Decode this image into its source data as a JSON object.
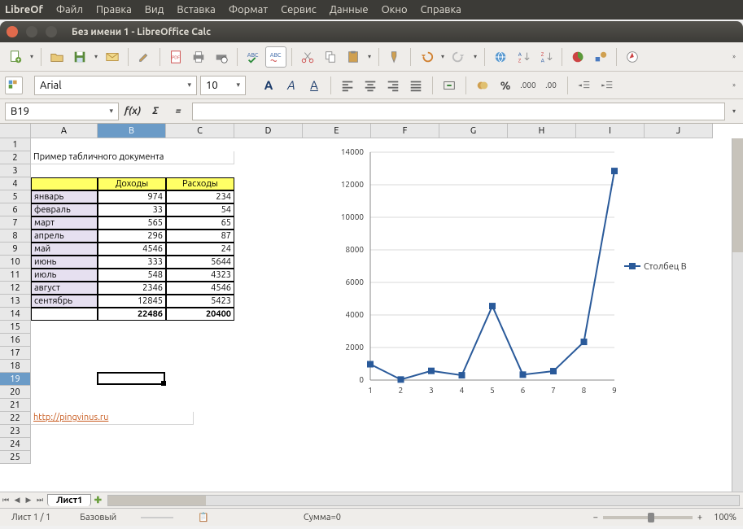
{
  "app_name": "LibreOf",
  "menu": [
    "Файл",
    "Правка",
    "Вид",
    "Вставка",
    "Формат",
    "Сервис",
    "Данные",
    "Окно",
    "Справка"
  ],
  "window_title": "Без имени 1 - LibreOffice Calc",
  "font": {
    "name": "Arial",
    "size": "10"
  },
  "name_box": "B19",
  "columns": [
    "A",
    "B",
    "C",
    "D",
    "E",
    "F",
    "G",
    "H",
    "I",
    "J"
  ],
  "col_widths": {
    "A": 82,
    "B": 84,
    "C": 84,
    "default": 84
  },
  "row_count": 25,
  "selected_col": "B",
  "selected_row": 19,
  "table_title": "Пример табличного документа",
  "headers": {
    "b": "Доходы",
    "c": "Расходы"
  },
  "rows": [
    {
      "m": "январь",
      "b": 974,
      "c": 234
    },
    {
      "m": "февраль",
      "b": 33,
      "c": 54
    },
    {
      "m": "март",
      "b": 565,
      "c": 65
    },
    {
      "m": "апрель",
      "b": 296,
      "c": 87
    },
    {
      "m": "май",
      "b": 4546,
      "c": 24
    },
    {
      "m": "июнь",
      "b": 333,
      "c": 5644
    },
    {
      "m": "июль",
      "b": 548,
      "c": 4323
    },
    {
      "m": "август",
      "b": 2346,
      "c": 4546
    },
    {
      "m": "сентябрь",
      "b": 12845,
      "c": 5423
    }
  ],
  "totals": {
    "b": 22486,
    "c": 20400
  },
  "link_cell": "http://pingvinus.ru",
  "sheet_tab": "Лист1",
  "status": {
    "sheet": "Лист 1 / 1",
    "style": "Базовый",
    "sum": "Сумма=0",
    "zoom": "100%"
  },
  "chart_data": {
    "type": "line",
    "title": "",
    "x": [
      1,
      2,
      3,
      4,
      5,
      6,
      7,
      8,
      9
    ],
    "series": [
      {
        "name": "Столбец B",
        "values": [
          974,
          33,
          565,
          296,
          4546,
          333,
          548,
          2346,
          12845
        ]
      }
    ],
    "xlabel": "",
    "ylabel": "",
    "ylim": [
      0,
      14000
    ],
    "yticks": [
      0,
      2000,
      4000,
      6000,
      8000,
      10000,
      12000,
      14000
    ],
    "legend_position": "right",
    "grid": true,
    "markers": "square"
  }
}
